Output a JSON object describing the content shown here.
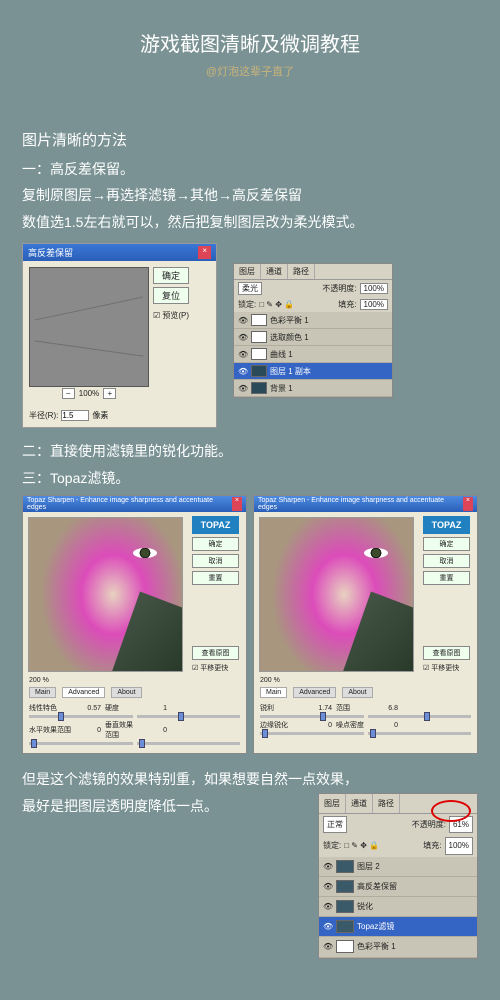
{
  "title": "游戏截图清晰及微调教程",
  "author": "@灯泡这辈子直了",
  "intro": {
    "heading": "图片清晰的方法",
    "method1_label": "一：高反差保留。",
    "method1_steps": "复制原图层→再选择滤镜→其他→高反差保留",
    "method1_note": "数值选1.5左右就可以，然后把复制图层改为柔光模式。"
  },
  "hp_dialog": {
    "title": "高反差保留",
    "btn_ok": "确定",
    "btn_reset": "复位",
    "chk_preview": "☑ 预览(P)",
    "zoom_minus": "−",
    "zoom_pct": "100%",
    "zoom_plus": "+",
    "radius_label": "半径(R):",
    "radius_value": "1.5",
    "radius_unit": "像素"
  },
  "layers1": {
    "tabs": [
      "图层",
      "通道",
      "路径"
    ],
    "blend": "柔光",
    "opacity_label": "不透明度:",
    "opacity_value": "100%",
    "lock_label": "锁定:",
    "fill_label": "填充:",
    "fill_value": "100%",
    "items": [
      {
        "name": "色彩平衡 1"
      },
      {
        "name": "选取颜色 1"
      },
      {
        "name": "曲线 1"
      },
      {
        "name": "图层 1 副本",
        "sel": true
      },
      {
        "name": "背景 1"
      }
    ]
  },
  "methods": {
    "m2": "二：直接使用滤镜里的锐化功能。",
    "m3": "三：Topaz滤镜。"
  },
  "topaz": {
    "title": "Topaz Sharpen - Enhance image sharpness and accentuate edges",
    "logo": "TOPAZ",
    "btn_ok": "确定",
    "btn_cancel": "取消",
    "btn_reset": "重置",
    "btn_view": "查看原图",
    "chk_fast": "☑ 平移更快",
    "zoom": "200 %",
    "tabs": [
      "Main",
      "Advanced",
      "About"
    ],
    "left": {
      "active_tab": "Advanced",
      "sliders": [
        {
          "label": "线性特色",
          "value": "0.57",
          "pos": 28,
          "label2": "硬度",
          "value2": "1",
          "pos2": 40
        },
        {
          "label": "水平效果范围",
          "value": "0",
          "pos": 2,
          "label2": "垂直效果范围",
          "value2": "0",
          "pos2": 2
        }
      ]
    },
    "right": {
      "active_tab": "Main",
      "sliders": [
        {
          "label": "锐利",
          "value": "1.74",
          "pos": 58,
          "label2": "范围",
          "value2": "6.8",
          "pos2": 55
        },
        {
          "label": "边缘锐化",
          "value": "0",
          "pos": 2,
          "label2": "噪点密度",
          "value2": "0",
          "pos2": 2
        }
      ]
    }
  },
  "footer": {
    "line1": "但是这个滤镜的效果特别重，如果想要自然一点效果，",
    "line2": "最好是把图层透明度降低一点。"
  },
  "layers2": {
    "tabs": [
      "图层",
      "通道",
      "路径"
    ],
    "blend": "正常",
    "opacity_label": "不透明度:",
    "opacity_value": "61%",
    "lock_label": "锁定:",
    "fill_label": "填充:",
    "fill_value": "100%",
    "items": [
      {
        "name": "图层 2"
      },
      {
        "name": "高反差保留"
      },
      {
        "name": "锐化"
      },
      {
        "name": "Topaz滤镜",
        "sel": true
      },
      {
        "name": "色彩平衡 1"
      }
    ]
  }
}
